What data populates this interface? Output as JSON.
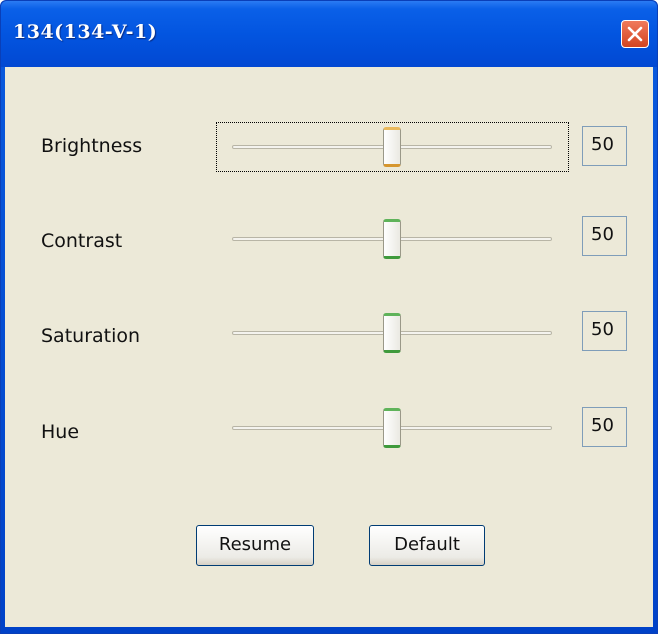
{
  "window": {
    "title": "134(134-V-1)"
  },
  "sliders": [
    {
      "label": "Brightness",
      "value": 50,
      "display": "50",
      "focused": true
    },
    {
      "label": "Contrast",
      "value": 50,
      "display": "50",
      "focused": false
    },
    {
      "label": "Saturation",
      "value": 50,
      "display": "50",
      "focused": false
    },
    {
      "label": "Hue",
      "value": 50,
      "display": "50",
      "focused": false
    }
  ],
  "buttons": {
    "resume_label": "Resume",
    "default_label": "Default"
  },
  "colors": {
    "titlebar": "#0355e0",
    "client_background": "#ece9d8",
    "close_button": "#d24421",
    "thumb_focused_accent": "#e9b85a",
    "thumb_accent": "#5fb35a"
  },
  "icons": {
    "close": "close-x-icon"
  }
}
